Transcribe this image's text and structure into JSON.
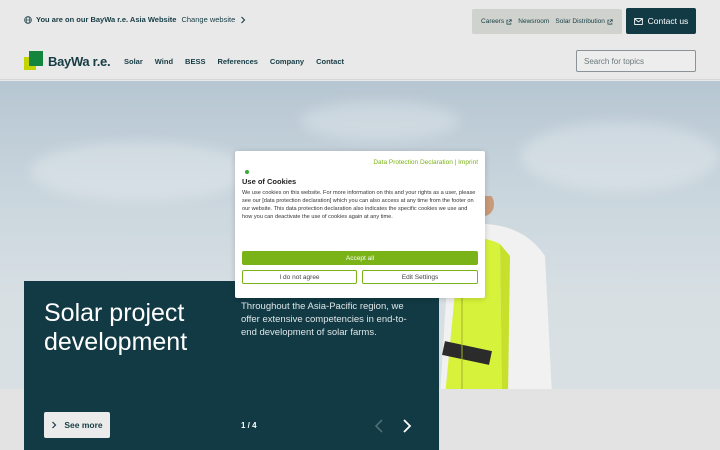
{
  "topbar": {
    "site_prefix": "You are on our BayWa r.e. Asia Website",
    "change_label": "Change website",
    "utility_links": [
      "Careers",
      "Newsroom",
      "Solar Distribution"
    ],
    "contact_label": "Contact us"
  },
  "nav": {
    "logo_text": "BayWa r.e.",
    "links": [
      "Solar",
      "Wind",
      "BESS",
      "References",
      "Company",
      "Contact"
    ],
    "search_placeholder": "Search for topics"
  },
  "hero": {
    "title": "Solar project development",
    "description": "Throughout the Asia-Pacific region, we offer extensive competencies in end-to-end development of solar farms.",
    "see_more_label": "See more",
    "pager": "1 / 4"
  },
  "cookie": {
    "links": "Data Protection Declaration | Imprint",
    "title": "Use of Cookies",
    "text": "We use cookies on this website. For more information on this and your rights as a user, please see our [data protection declaration] which you can also access at any time from the footer on our website. This data protection declaration also indicates the specific cookies we use and how you can deactivate the use of cookies again at any time.",
    "accept_label": "Accept all",
    "decline_label": "I do not agree",
    "settings_label": "Edit Settings"
  },
  "colors": {
    "brand_dark": "#113a44",
    "accent_green": "#7ab317",
    "logo_green": "#13853c",
    "logo_lime": "#c2d500"
  }
}
